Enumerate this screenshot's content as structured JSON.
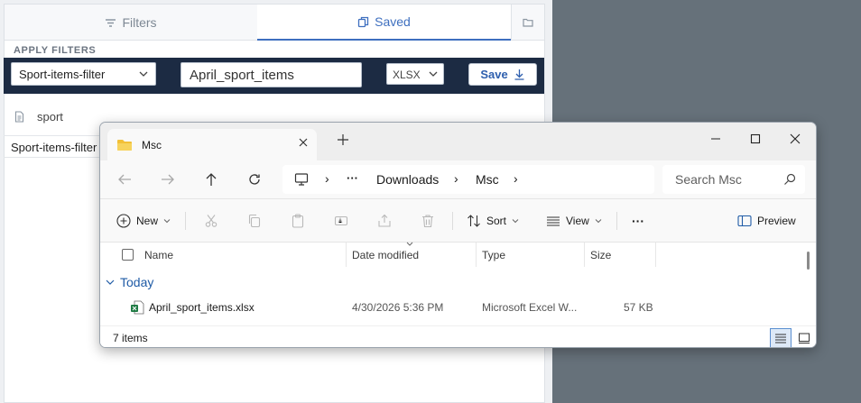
{
  "app": {
    "tabs": {
      "filters": "Filters",
      "saved": "Saved"
    },
    "section_title": "APPLY FILTERS",
    "filter_select": "Sport-items-filter",
    "file_name": "April_sport_items",
    "format": "XLSX",
    "save_label": "Save",
    "saved_item": "sport",
    "filter_tag": "Sport-items-filter",
    "accent_color": "#3e6fbf",
    "bar_color": "#1c2b43"
  },
  "explorer": {
    "tab_title": "Msc",
    "breadcrumb": {
      "ellipsis": "···",
      "downloads": "Downloads",
      "msc": "Msc"
    },
    "search_placeholder": "Search Msc",
    "toolbar": {
      "new": "New",
      "sort": "Sort",
      "view": "View",
      "more": "···",
      "preview": "Preview"
    },
    "columns": {
      "name": "Name",
      "date": "Date modified",
      "type": "Type",
      "size": "Size"
    },
    "group": "Today",
    "file": {
      "name": "April_sport_items.xlsx",
      "date": "4/30/2026 5:36 PM",
      "type": "Microsoft Excel W...",
      "size": "57 KB"
    },
    "status": "7 items",
    "folder_color": "#f2c037",
    "group_color": "#1f5ba6"
  }
}
